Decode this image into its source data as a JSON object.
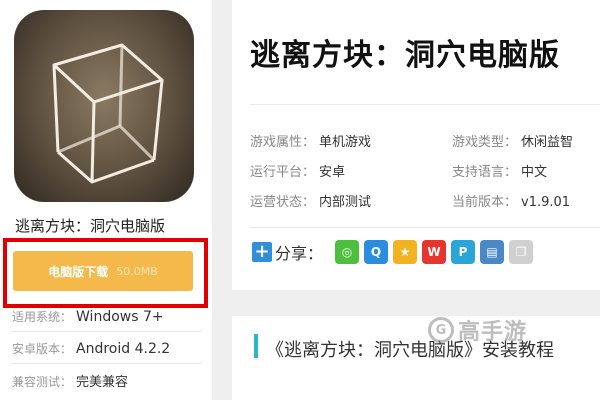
{
  "left": {
    "app_name": "逃离方块：洞穴电脑版",
    "download": {
      "label": "电脑版下载",
      "size": "50.0MB"
    },
    "info": [
      {
        "key": "适用系统：",
        "value": "Windows 7+"
      },
      {
        "key": "安卓版本：",
        "value": "Android 4.2.2"
      },
      {
        "key": "兼容测试：",
        "value": "完美兼容"
      }
    ]
  },
  "main": {
    "title": "逃离方块：洞穴电脑版",
    "attributes": [
      {
        "key": "游戏属性：",
        "value": "单机游戏"
      },
      {
        "key": "游戏类型：",
        "value": "休闲益智"
      },
      {
        "key": "运行平台：",
        "value": "安卓"
      },
      {
        "key": "支持语言：",
        "value": "中文"
      },
      {
        "key": "运营状态：",
        "value": "内部测试"
      },
      {
        "key": "当前版本：",
        "value": "v1.9.01"
      }
    ],
    "share": {
      "label": "分享：",
      "icons": [
        {
          "name": "wechat-icon",
          "color": "#4cbf3c",
          "glyph": "◎"
        },
        {
          "name": "qq-icon",
          "color": "#2a8de0",
          "glyph": "Q"
        },
        {
          "name": "qzone-icon",
          "color": "#f2b322",
          "glyph": "★"
        },
        {
          "name": "weibo-icon",
          "color": "#e6352f",
          "glyph": "W"
        },
        {
          "name": "tencent-weibo-icon",
          "color": "#2aa6d6",
          "glyph": "P"
        },
        {
          "name": "print-icon",
          "color": "#4a88c8",
          "glyph": "▤"
        },
        {
          "name": "copy-icon",
          "color": "#d0d0d0",
          "glyph": "❐"
        }
      ]
    }
  },
  "section": {
    "title": "《逃离方块：洞穴电脑版》安装教程"
  },
  "watermark": {
    "text": "高手游",
    "glyph": "G"
  }
}
